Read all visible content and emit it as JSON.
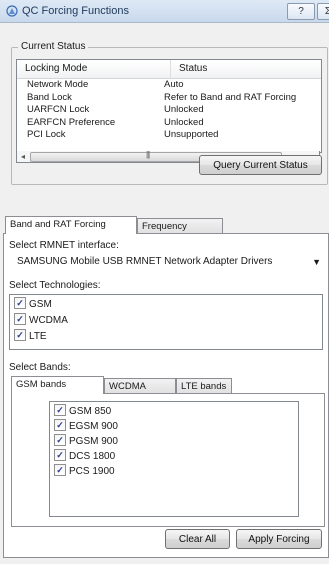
{
  "window": {
    "title": "QC Forcing Functions",
    "help_label": "?",
    "close_label": "Σ"
  },
  "current_status": {
    "group_title": "Current Status",
    "columns": [
      "Locking Mode",
      "Status"
    ],
    "rows": [
      {
        "mode": "Network Mode",
        "status": "Auto"
      },
      {
        "mode": "Band Lock",
        "status": "Refer to Band and RAT Forcing"
      },
      {
        "mode": "UARFCN Lock",
        "status": "Unlocked"
      },
      {
        "mode": "EARFCN Preference",
        "status": "Unlocked"
      },
      {
        "mode": "PCI Lock",
        "status": "Unsupported"
      }
    ],
    "scroll_grip": "|||",
    "query_button": "Query Current Status"
  },
  "tabs": {
    "band_rat": "Band and RAT Forcing",
    "frequency": "Frequency Forcing"
  },
  "rmnet": {
    "label": "Select RMNET interface:",
    "value": "SAMSUNG Mobile USB RMNET Network Adapter Drivers"
  },
  "technologies": {
    "label": "Select Technologies:",
    "items": [
      {
        "name": "GSM",
        "checked": true
      },
      {
        "name": "WCDMA",
        "checked": true
      },
      {
        "name": "LTE",
        "checked": true
      }
    ]
  },
  "bands": {
    "label": "Select Bands:",
    "tabs": [
      "GSM bands",
      "WCDMA bands",
      "LTE bands"
    ],
    "gsm_items": [
      {
        "name": "GSM 850",
        "checked": true
      },
      {
        "name": "EGSM 900",
        "checked": true
      },
      {
        "name": "PGSM 900",
        "checked": true
      },
      {
        "name": "DCS 1800",
        "checked": true
      },
      {
        "name": "PCS 1900",
        "checked": true
      }
    ]
  },
  "actions": {
    "clear_all": "Clear All",
    "apply_forcing": "Apply Forcing"
  },
  "icons": {
    "app": "signal-tower-icon",
    "check": "✓",
    "scroll_left": "◂",
    "scroll_right": "▸",
    "combo_arrow": "▼"
  }
}
